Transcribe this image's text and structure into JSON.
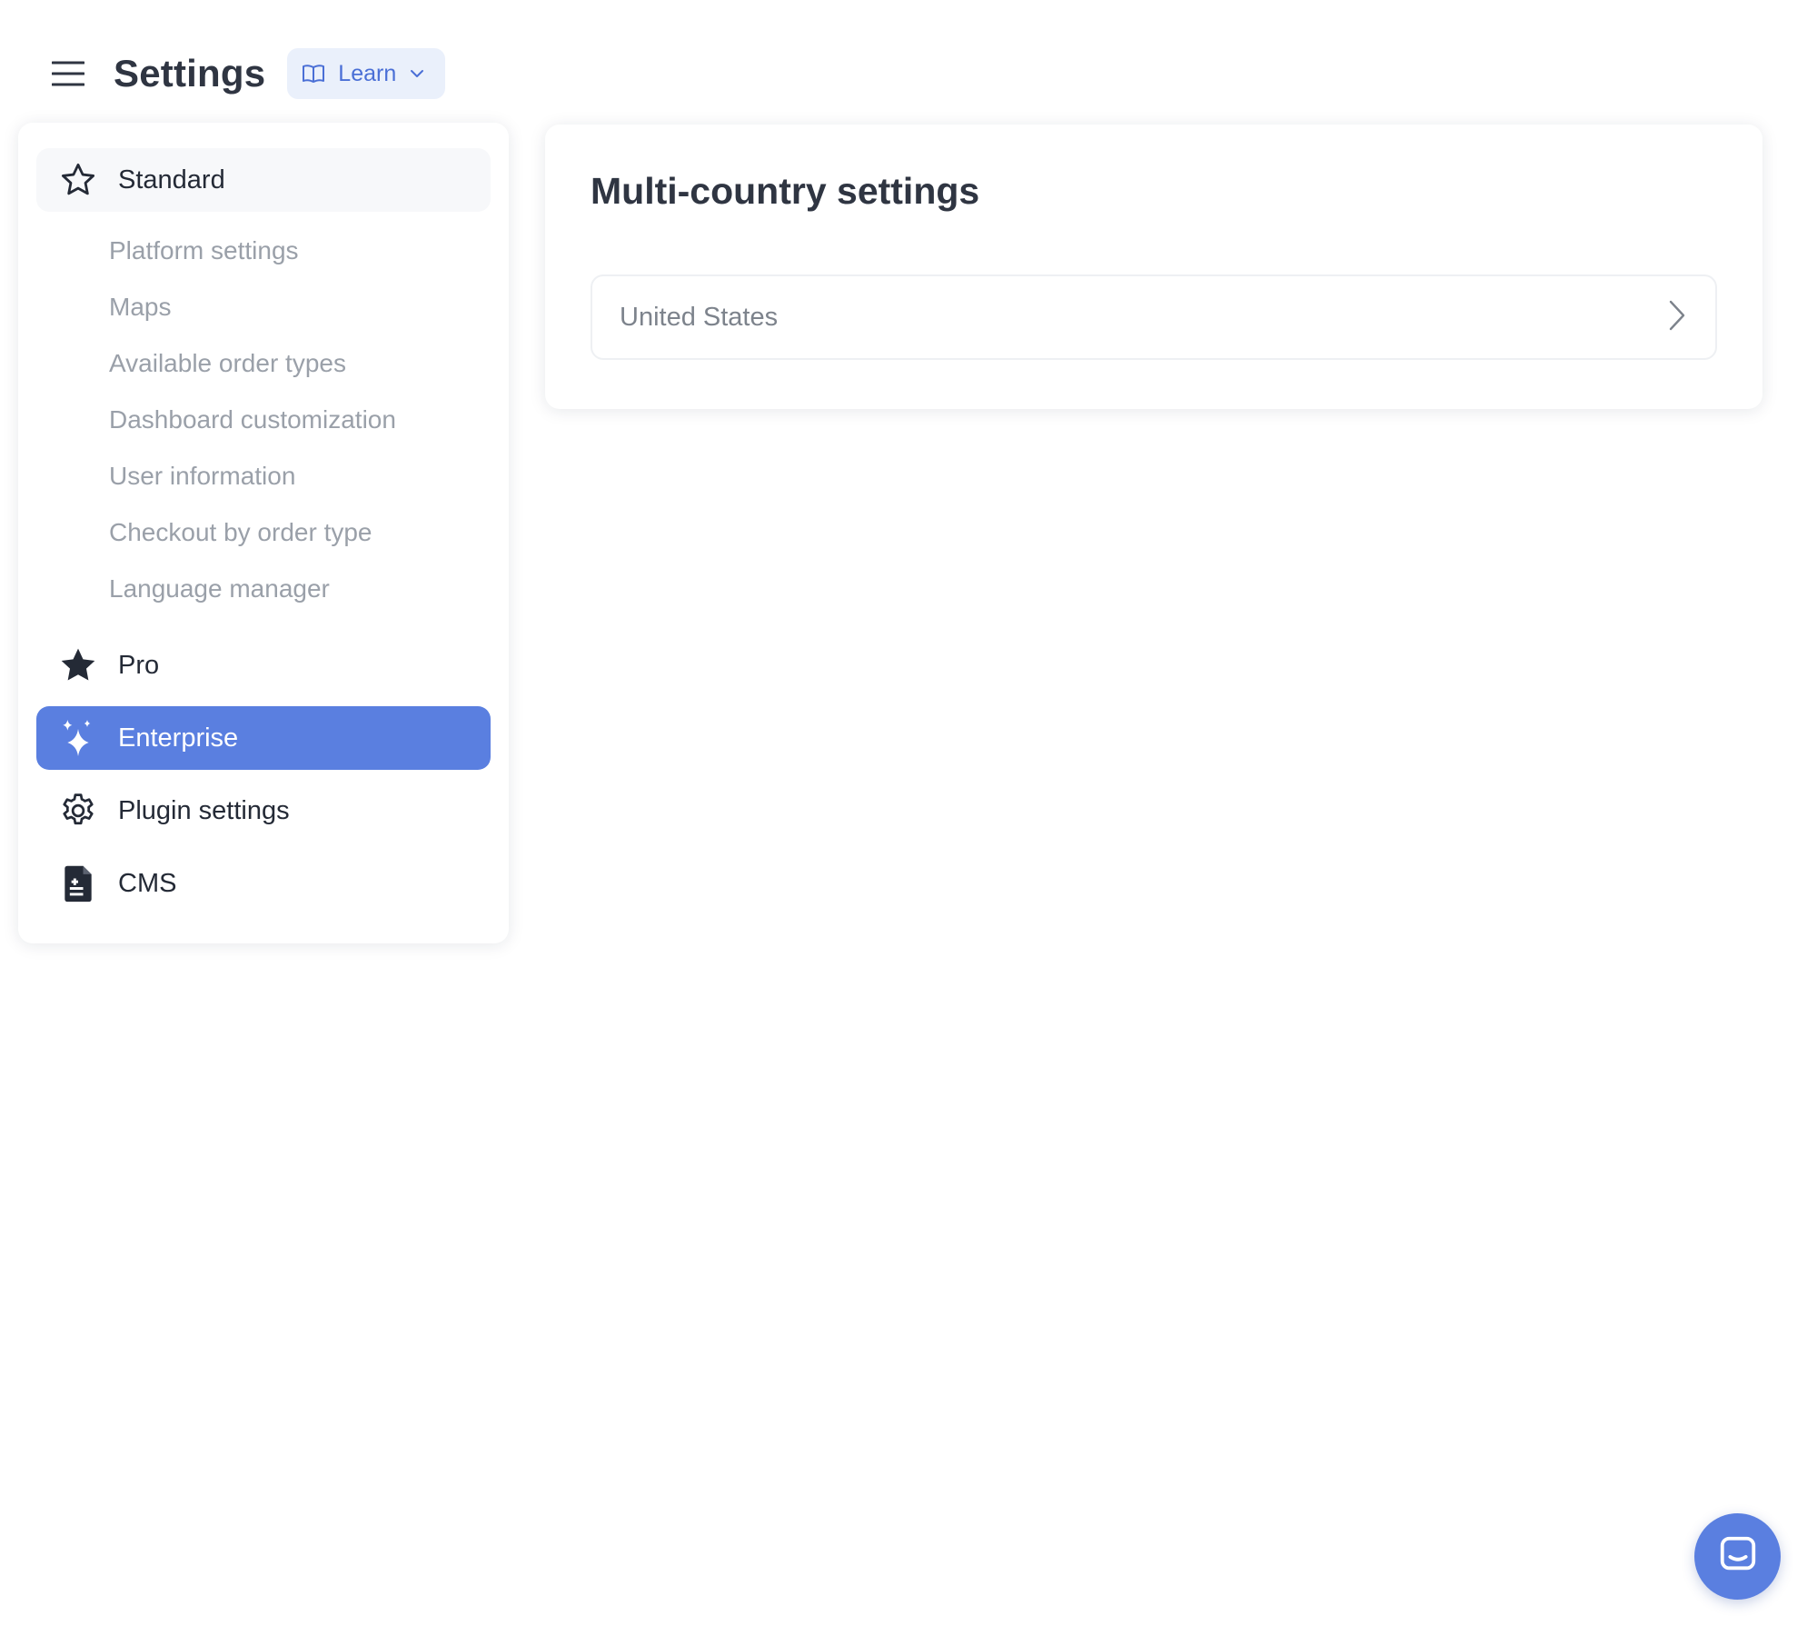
{
  "header": {
    "title": "Settings",
    "learn_label": "Learn",
    "menu_icon": "hamburger-menu-icon",
    "learn_icon": "book-icon",
    "learn_chevron_icon": "chevron-down-icon"
  },
  "sidebar": {
    "sections": [
      {
        "label": "Standard",
        "icon": "star-outline-icon",
        "items": [
          {
            "label": "Platform settings"
          },
          {
            "label": "Maps"
          },
          {
            "label": "Available order types"
          },
          {
            "label": "Dashboard customization"
          },
          {
            "label": "User information"
          },
          {
            "label": "Checkout by order type"
          },
          {
            "label": "Language manager"
          }
        ]
      },
      {
        "label": "Pro",
        "icon": "star-filled-icon"
      },
      {
        "label": "Enterprise",
        "icon": "sparkles-icon",
        "active": true
      },
      {
        "label": "Plugin settings",
        "icon": "gear-icon"
      },
      {
        "label": "CMS",
        "icon": "document-icon"
      }
    ]
  },
  "main": {
    "title": "Multi-country settings",
    "countries": [
      {
        "name": "United States",
        "icon": "chevron-right-icon"
      }
    ]
  },
  "chat": {
    "icon": "chat-bubble-icon"
  },
  "colors": {
    "accent": "#5a7fe0",
    "learn_bg": "#eaf0fb",
    "learn_text": "#4a6fd6",
    "title_text": "#2f3542",
    "muted_text": "#9aa0a9"
  }
}
